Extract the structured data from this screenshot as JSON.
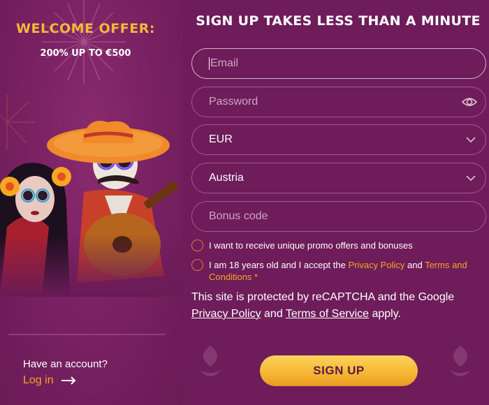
{
  "welcome": {
    "title": "WELCOME OFFER:",
    "subtitle": "200% UP TO €500"
  },
  "account": {
    "question": "Have an account?",
    "login_label": "Log in"
  },
  "form": {
    "heading": "SIGN UP TAKES LESS THAN A MINUTE",
    "email_placeholder": "Email",
    "password_placeholder": "Password",
    "currency_value": "EUR",
    "country_value": "Austria",
    "bonus_placeholder": "Bonus code",
    "promo_checkbox_label": "I want to receive unique promo offers and bonuses",
    "age_checkbox": {
      "text_before": "I am 18 years old and I accept the ",
      "privacy_link": "Privacy Policy",
      "text_and": " and ",
      "terms_link": "Terms and Conditions",
      "required_mark": " *"
    },
    "recaptcha": {
      "text_before": "This site is protected by reCAPTCHA and the Google ",
      "privacy_link": "Privacy Policy",
      "text_and": " and ",
      "terms_link": "Terms of Service",
      "text_after": " apply."
    },
    "signup_label": "SIGN UP"
  },
  "colors": {
    "background": "#6e1c5a",
    "accent_orange": "#f5a623",
    "button_gold": "#f5b534"
  },
  "icons": {
    "password_toggle": "eye-icon",
    "dropdown": "chevron-down-icon",
    "login_arrow": "arrow-right-icon"
  }
}
